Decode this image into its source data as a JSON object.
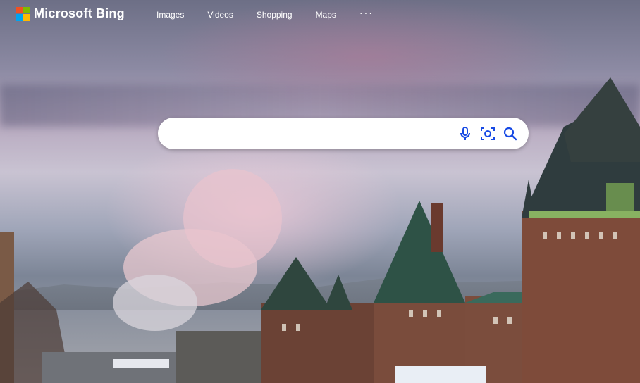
{
  "brand": {
    "name": "Microsoft Bing"
  },
  "nav": {
    "items": [
      "Images",
      "Videos",
      "Shopping",
      "Maps"
    ],
    "more": "···"
  },
  "search": {
    "value": "",
    "placeholder": ""
  },
  "icons": {
    "logo": "microsoft-logo-icon",
    "mic": "microphone-icon",
    "visual": "visual-search-icon",
    "search": "search-icon"
  },
  "colors": {
    "logo_red": "#f25022",
    "logo_green": "#7fba00",
    "logo_blue": "#00a4ef",
    "logo_yellow": "#ffb900",
    "icon_accent": "#174ae4"
  }
}
